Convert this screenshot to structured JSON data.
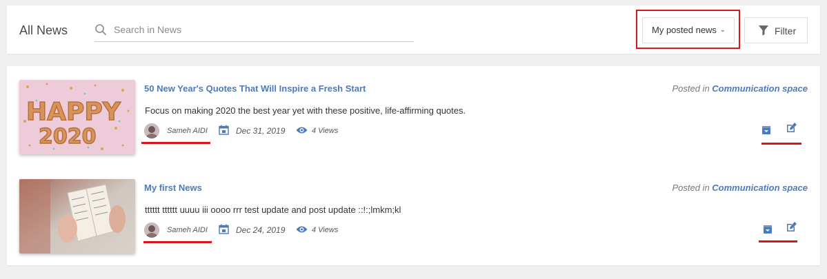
{
  "header": {
    "title": "All News",
    "search_placeholder": "Search in News",
    "dropdown_label": "My posted news",
    "filter_label": "Filter"
  },
  "news": [
    {
      "title": "50 New Year's Quotes That Will Inspire a Fresh Start",
      "description": "Focus on making 2020 the best year yet with these positive, life-affirming quotes.",
      "author": "Sameh AIDI",
      "date": "Dec 31, 2019",
      "views": "4 Views",
      "posted_prefix": "Posted in",
      "space": "Communication space",
      "thumb_text_1": "HAPPY",
      "thumb_text_2": "2020"
    },
    {
      "title": "My first News",
      "description": "tttttt tttttt uuuu iii oooo rrr test update and post update ::!:;lmkm;kl",
      "author": "Sameh AIDI",
      "date": "Dec 24, 2019",
      "views": "4 Views",
      "posted_prefix": "Posted in",
      "space": "Communication space"
    }
  ],
  "colors": {
    "accent": "#4d7ab8",
    "highlight": "#d9141b",
    "background": "#f0f0f0"
  },
  "icons": [
    "search-icon",
    "chevron-down-icon",
    "funnel-icon",
    "calendar-icon",
    "eye-icon",
    "archive-icon",
    "edit-icon"
  ]
}
